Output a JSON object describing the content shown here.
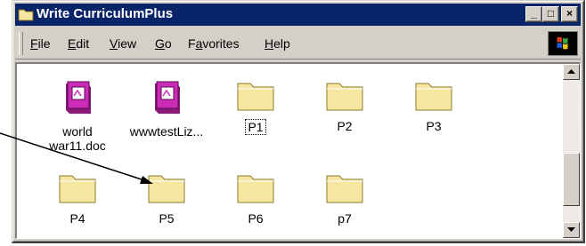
{
  "window": {
    "title": "Write CurriculumPlus"
  },
  "titlebar_buttons": {
    "minimize": "_",
    "maximize": "□",
    "close": "×"
  },
  "menu": [
    {
      "label": "File",
      "accel": "F",
      "rest": "ile"
    },
    {
      "label": "Edit",
      "accel": "E",
      "rest": "dit"
    },
    {
      "label": "View",
      "accel": "V",
      "rest": "iew"
    },
    {
      "label": "Go",
      "accel": "G",
      "rest": "o"
    },
    {
      "label": "Favorites",
      "pre": "F",
      "accel": "a",
      "rest": "vorites"
    },
    {
      "label": "Help",
      "accel": "H",
      "rest": "elp"
    }
  ],
  "items": [
    {
      "label": "world\nwar11.doc",
      "type": "doc",
      "name": "world-war11-doc"
    },
    {
      "label": "wwwtestLiz...",
      "type": "doc",
      "name": "wwwtestliz"
    },
    {
      "label": "P1",
      "type": "folder",
      "focused": true
    },
    {
      "label": "P2",
      "type": "folder"
    },
    {
      "label": "P3",
      "type": "folder"
    },
    {
      "label": "P4",
      "type": "folder"
    },
    {
      "label": "P5",
      "type": "folder"
    },
    {
      "label": "P6",
      "type": "folder"
    },
    {
      "label": "p7",
      "type": "folder"
    }
  ],
  "colors": {
    "titlebar": "#0a246a",
    "folder": "#f5e7a0",
    "book": "#cc2bb7"
  }
}
